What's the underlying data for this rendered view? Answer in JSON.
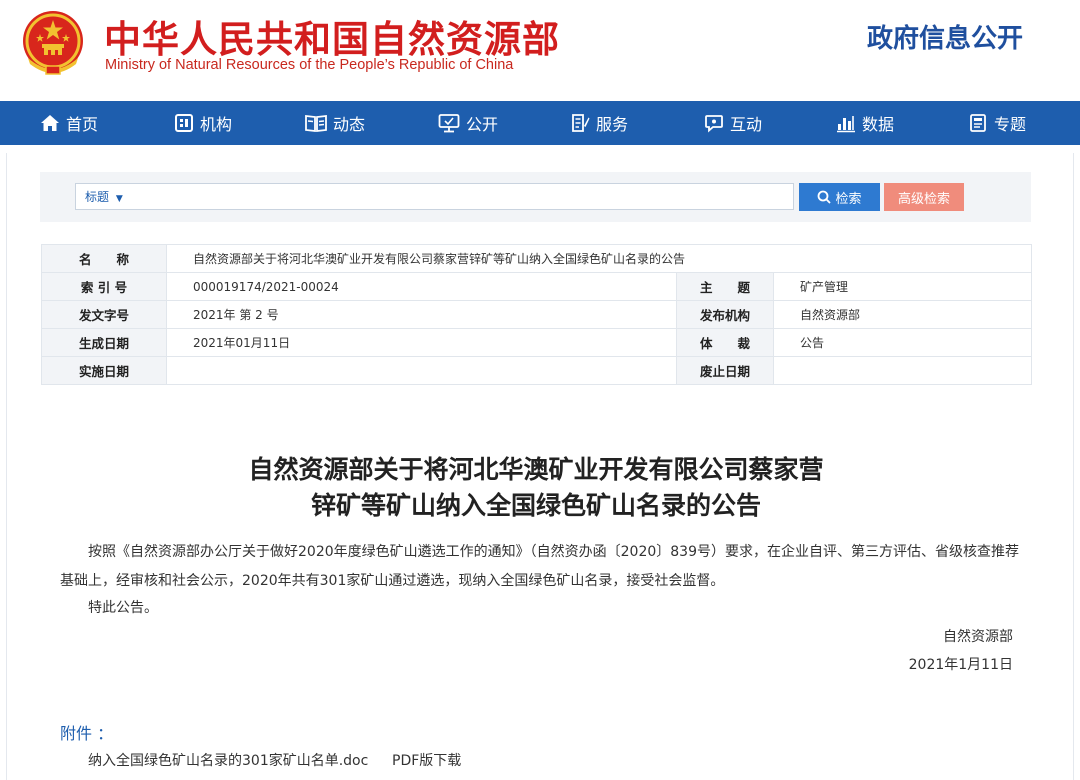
{
  "header": {
    "title": "中华人民共和国自然资源部",
    "subtitle": "Ministry of Natural Resources of the People’s Republic of China",
    "gov_info": "政府信息公开",
    "colors": {
      "title_red": "#d21e1e",
      "gov_info_blue": "#1f4f9e"
    }
  },
  "nav": {
    "background": "#1e5eae",
    "items": [
      {
        "label": "首页",
        "icon": "home-icon"
      },
      {
        "label": "机构",
        "icon": "organization-icon"
      },
      {
        "label": "动态",
        "icon": "news-icon"
      },
      {
        "label": "公开",
        "icon": "disclosure-icon"
      },
      {
        "label": "服务",
        "icon": "service-icon"
      },
      {
        "label": "互动",
        "icon": "interaction-icon"
      },
      {
        "label": "数据",
        "icon": "data-chart-icon"
      },
      {
        "label": "专题",
        "icon": "topic-icon"
      }
    ]
  },
  "search": {
    "type_selected": "标题",
    "query": "",
    "search_label": "检索",
    "advanced_label": "高级检索",
    "colors": {
      "search_btn": "#2e7ad1",
      "advanced_btn": "#f08c7c"
    }
  },
  "meta": {
    "name_label": "名　　称",
    "name_value": "自然资源部关于将河北华澳矿业开发有限公司蔡家营锌矿等矿山纳入全国绿色矿山名录的公告",
    "index_label": "索 引 号",
    "index_value": "000019174/2021-00024",
    "topic_label": "主　　题",
    "topic_value": "矿产管理",
    "doc_no_label": "发文字号",
    "doc_no_value": "2021年 第 2 号",
    "publisher_label": "发布机构",
    "publisher_value": "自然资源部",
    "created_label": "生成日期",
    "created_value": "2021年01月11日",
    "genre_label": "体　　裁",
    "genre_value": "公告",
    "effective_label": "实施日期",
    "effective_value": "",
    "expiry_label": "废止日期",
    "expiry_value": ""
  },
  "article": {
    "title_line1": "自然资源部关于将河北华澳矿业开发有限公司蔡家营",
    "title_line2": "锌矿等矿山纳入全国绿色矿山名录的公告",
    "paragraph1": "按照《自然资源部办公厅关于做好2020年度绿色矿山遴选工作的通知》（自然资办函〔2020〕839号）要求，在企业自评、第三方评估、省级核查推荐基础上，经审核和社会公示，2020年共有301家矿山通过遴选，现纳入全国绿色矿山名录，接受社会监督。",
    "paragraph2": "特此公告。",
    "signature_org": "自然资源部",
    "signature_date": "2021年1月11日"
  },
  "attachments": {
    "label": "附件 ：",
    "file_name": "纳入全国绿色矿山名录的301家矿山名单.doc",
    "pdf_link": "PDF版下载"
  }
}
